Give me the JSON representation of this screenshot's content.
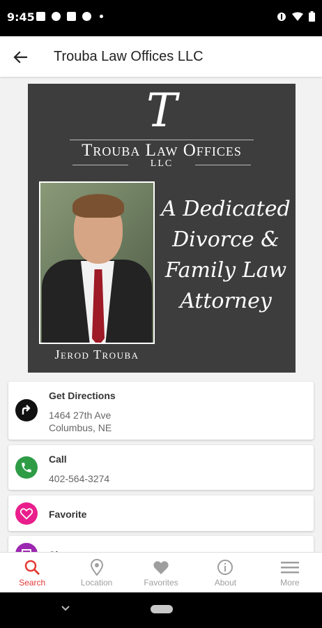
{
  "status_bar": {
    "time": "9:45"
  },
  "app_bar": {
    "title": "Trouba Law Offices LLC"
  },
  "hero": {
    "logo_letter": "T",
    "firm_name": "Trouba Law Offices",
    "firm_suffix": "LLC",
    "tagline": [
      "A Dedicated",
      "Divorce &",
      "Family Law",
      "Attorney"
    ],
    "attorney_name": "Jerod Trouba"
  },
  "actions": {
    "directions": {
      "title": "Get Directions",
      "address_line1": "1464 27th Ave",
      "address_line2": "Columbus, NE"
    },
    "call": {
      "title": "Call",
      "phone": "402-564-3274"
    },
    "favorite": {
      "title": "Favorite"
    },
    "share": {
      "title": "Share"
    }
  },
  "bottom_nav": {
    "items": [
      {
        "label": "Search",
        "icon": "search-icon",
        "active": true
      },
      {
        "label": "Location",
        "icon": "location-pin-icon",
        "active": false
      },
      {
        "label": "Favorites",
        "icon": "heart-icon",
        "active": false
      },
      {
        "label": "About",
        "icon": "info-icon",
        "active": false
      },
      {
        "label": "More",
        "icon": "menu-icon",
        "active": false
      }
    ]
  },
  "colors": {
    "active": "#e53935",
    "inactive": "#9e9e9e",
    "directions_icon": "#111111",
    "call_icon": "#2e9b45",
    "favorite_icon": "#e91e8c",
    "share_icon": "#9c27b0"
  }
}
